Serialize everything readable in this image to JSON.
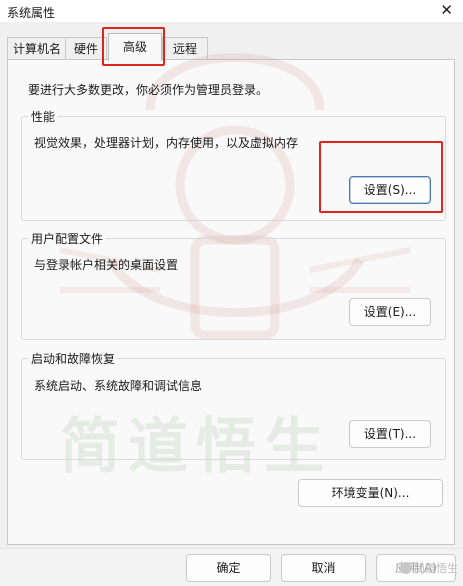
{
  "window": {
    "title": "系统属性"
  },
  "tabs": [
    {
      "label": "计算机名"
    },
    {
      "label": "硬件"
    },
    {
      "label": "高级"
    },
    {
      "label": "远程"
    }
  ],
  "main": {
    "admin_note": "要进行大多数更改，你必须作为管理员登录。",
    "performance": {
      "legend": "性能",
      "description": "视觉效果，处理器计划，内存使用，以及虚拟内存",
      "button_label": "设置(S)..."
    },
    "user_profiles": {
      "legend": "用户配置文件",
      "description": "与登录帐户相关的桌面设置",
      "button_label": "设置(E)..."
    },
    "startup_recovery": {
      "legend": "启动和故障恢复",
      "description": "系统启动、系统故障和调试信息",
      "button_label": "设置(T)..."
    },
    "env_button_label": "环境变量(N)..."
  },
  "footer": {
    "ok_label": "确定",
    "cancel_label": "取消",
    "apply_label": "应用(A)"
  },
  "watermark": {
    "text": "简道悟生",
    "corner_text": "简道悟生"
  },
  "colors": {
    "highlight": "#e0241f",
    "watermark_green": "#5a9a5a",
    "watermark_red": "#c46a5a"
  }
}
